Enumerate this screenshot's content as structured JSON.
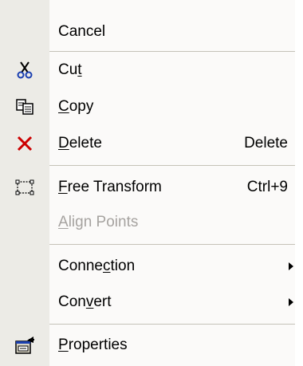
{
  "menu": {
    "cancel": {
      "label": "Cancel"
    },
    "cut": {
      "pre": "Cu",
      "key": "t",
      "post": "",
      "icon": "scissors-icon"
    },
    "copy": {
      "pre": "",
      "key": "C",
      "post": "opy",
      "icon": "copy-icon"
    },
    "delete": {
      "pre": "",
      "key": "D",
      "post": "elete",
      "shortcut": "Delete",
      "icon": "delete-x-icon",
      "icon_color": "#cc0000"
    },
    "free_transform": {
      "pre": "",
      "key": "F",
      "post": "ree Transform",
      "shortcut": "Ctrl+9",
      "icon": "free-transform-icon"
    },
    "align_points": {
      "pre": "",
      "key": "A",
      "post": "lign Points",
      "enabled": false
    },
    "connection": {
      "pre": "Conne",
      "key": "c",
      "post": "tion",
      "submenu": true
    },
    "convert": {
      "pre": "Con",
      "key": "v",
      "post": "ert",
      "submenu": true
    },
    "properties": {
      "pre": "",
      "key": "P",
      "post": "roperties",
      "icon": "properties-icon"
    }
  },
  "colors": {
    "menu_background": "#fbfaf9",
    "gutter_background": "#ecebe6",
    "separator": "#c5c2b8",
    "disabled_text": "#a6a3a0"
  }
}
